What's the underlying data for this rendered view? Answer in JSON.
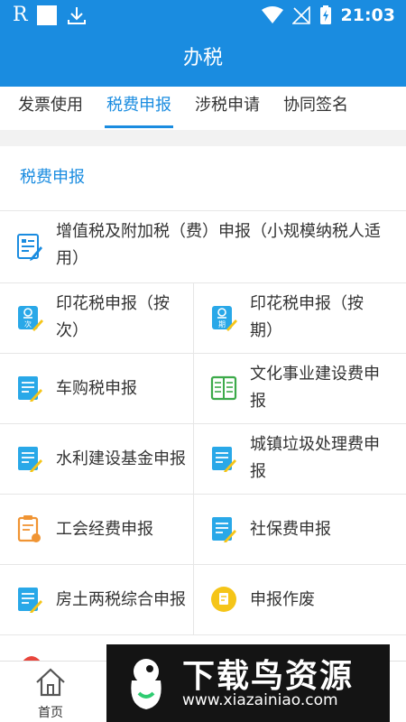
{
  "status_bar": {
    "left_glyph": "R",
    "time": "21:03"
  },
  "header": {
    "title": "办税"
  },
  "tabs": [
    {
      "label": "发票使用"
    },
    {
      "label": "税费申报"
    },
    {
      "label": "涉税申请"
    },
    {
      "label": "协同签名"
    }
  ],
  "section": {
    "title": "税费申报"
  },
  "items": {
    "vat": {
      "label": "增值税及附加税（费）申报（小规模纳税人适用）",
      "icon": "form-edit-icon"
    },
    "stamp_times": {
      "label": "印花税申报（按次）",
      "icon": "stamp-times-icon",
      "badge": "次"
    },
    "stamp_period": {
      "label": "印花税申报（按期）",
      "icon": "stamp-period-icon",
      "badge": "期"
    },
    "vehicle": {
      "label": "车购税申报",
      "icon": "document-edit-icon"
    },
    "culture": {
      "label": "文化事业建设费申报",
      "icon": "book-icon"
    },
    "water": {
      "label": "水利建设基金申报",
      "icon": "document-edit-icon"
    },
    "garbage": {
      "label": "城镇垃圾处理费申报",
      "icon": "document-edit-icon"
    },
    "union": {
      "label": "工会经费申报",
      "icon": "clipboard-edit-icon"
    },
    "social": {
      "label": "社保费申报",
      "icon": "document-edit-icon"
    },
    "property": {
      "label": "房土两税综合申报",
      "icon": "document-edit-icon"
    },
    "void": {
      "label": "申报作废",
      "icon": "void-icon"
    }
  },
  "bottom_nav": {
    "home_label": "首页"
  },
  "watermark": {
    "title": "下载鸟资源",
    "url": "www.xiazainiao.com"
  },
  "colors": {
    "primary": "#1a8ce0",
    "text": "#333333",
    "divider": "#e6e6e6",
    "icon_orange": "#f09433",
    "icon_green": "#3caa4a",
    "icon_yellow": "#f5c518"
  }
}
